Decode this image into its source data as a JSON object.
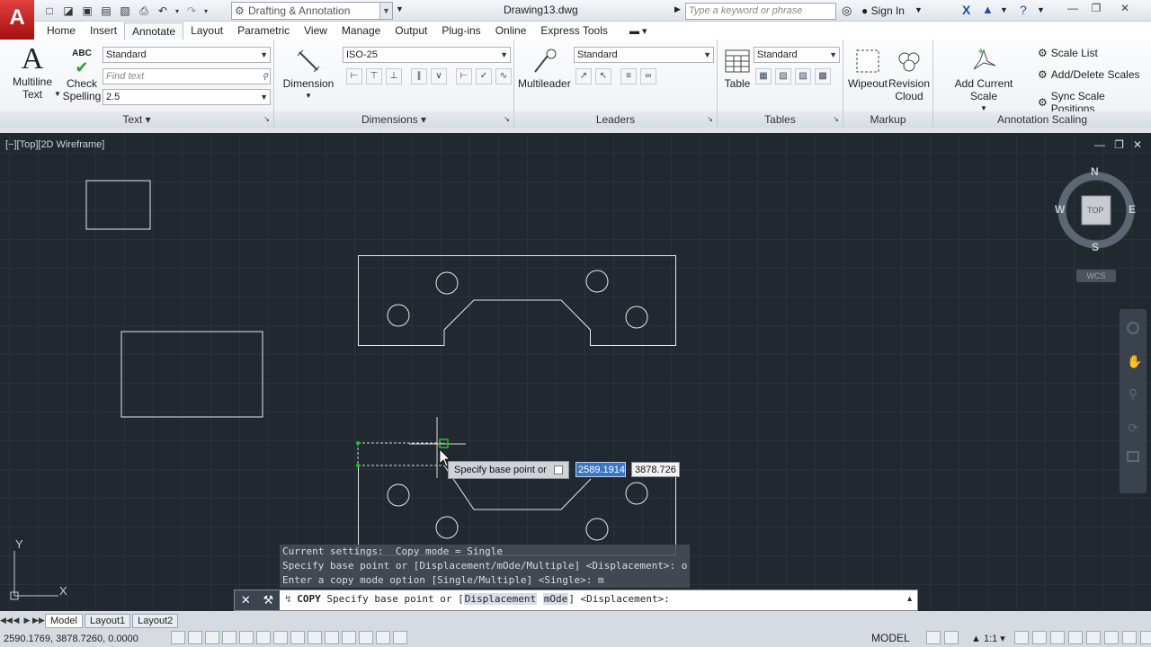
{
  "window": {
    "title": "Drawing13.dwg"
  },
  "app": {
    "logo": "A"
  },
  "workspace": {
    "value": "Drafting & Annotation"
  },
  "search": {
    "placeholder": "Type a keyword or phrase"
  },
  "account": {
    "signin": "Sign In"
  },
  "tabs": [
    "Home",
    "Insert",
    "Annotate",
    "Layout",
    "Parametric",
    "View",
    "Manage",
    "Output",
    "Plug-ins",
    "Online",
    "Express Tools"
  ],
  "active_tab": "Annotate",
  "ribbon": {
    "text_panel": {
      "title": "Text",
      "multiline": "Multiline\nText",
      "multiline_1": "Multiline",
      "multiline_2": "Text",
      "check_1": "Check",
      "check_2": "Spelling",
      "check_icon_text": "ABC",
      "style": "Standard",
      "find_placeholder": "Find text",
      "height": "2.5"
    },
    "dimensions_panel": {
      "title": "Dimensions",
      "dimension": "Dimension",
      "style": "ISO-25"
    },
    "leaders_panel": {
      "title": "Leaders",
      "multileader": "Multileader",
      "style": "Standard"
    },
    "tables_panel": {
      "title": "Tables",
      "table": "Table",
      "style": "Standard"
    },
    "markup_panel": {
      "title": "Markup",
      "wipeout": "Wipeout",
      "revision_1": "Revision",
      "revision_2": "Cloud"
    },
    "scaling_panel": {
      "title": "Annotation Scaling",
      "add_current": "Add Current Scale",
      "scale_list": "Scale List",
      "add_delete": "Add/Delete Scales",
      "sync": "Sync Scale Positions"
    }
  },
  "viewport": {
    "label": "[−][Top][2D Wireframe]"
  },
  "viewcube": {
    "n": "N",
    "s": "S",
    "e": "E",
    "w": "W",
    "face": "TOP",
    "wcs": "WCS"
  },
  "dynamic_input": {
    "prompt": "Specify base point or",
    "x": "2589.1914",
    "y": "3878.726"
  },
  "history": [
    "Current settings:  Copy mode = Single",
    "Specify base point or [Displacement/mOde/Multiple] <Displacement>: o",
    "Enter a copy mode option [Single/Multiple] <Single>: m"
  ],
  "command": {
    "name": "COPY",
    "prompt": "Specify base point or [",
    "kw1": "Displacement",
    "kw2": "mOde",
    "suffix": "] <Displacement>:"
  },
  "ucs": {
    "x": "X",
    "y": "Y"
  },
  "layouts": [
    "Model",
    "Layout1",
    "Layout2"
  ],
  "status": {
    "coords": "2590.1769, 3878.7260, 0.0000",
    "space": "MODEL",
    "scale": "1:1"
  }
}
